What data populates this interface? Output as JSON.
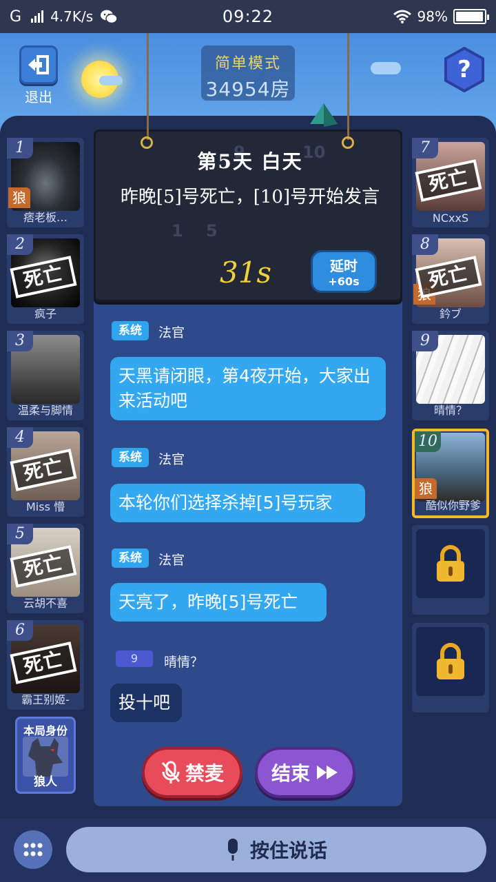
{
  "status_bar": {
    "carrier": "G",
    "speed": "4.7K/s",
    "time": "09:22",
    "battery": "98%",
    "battery_level": 0.98
  },
  "header": {
    "exit_label": "退出",
    "mode": "简单模式",
    "room": "34954房"
  },
  "day_board": {
    "title": "第5天 白天",
    "message": "昨晚[5]号死亡，[10]号开始发言",
    "timer": "31s",
    "extend_label": "延时",
    "extend_amount": "+60s"
  },
  "players_left": [
    {
      "number": "1",
      "name": "痞老板…",
      "wolf": "狼",
      "dead": ""
    },
    {
      "number": "2",
      "name": "疯子",
      "wolf": "",
      "dead": "死亡"
    },
    {
      "number": "3",
      "name": "温柔与脚情",
      "wolf": "",
      "dead": ""
    },
    {
      "number": "4",
      "name": "Miss 懵",
      "wolf": "",
      "dead": "死亡"
    },
    {
      "number": "5",
      "name": "云胡不喜",
      "wolf": "",
      "dead": "死亡"
    },
    {
      "number": "6",
      "name": "霸王别姬-",
      "wolf": "",
      "dead": "死亡"
    }
  ],
  "players_right": [
    {
      "number": "7",
      "name": "NCxxS",
      "wolf": "",
      "dead": "死亡"
    },
    {
      "number": "8",
      "name": "鈐ブ",
      "wolf": "狼",
      "dead": "死亡"
    },
    {
      "number": "9",
      "name": "晴情？",
      "wolf": "",
      "dead": ""
    },
    {
      "number": "10",
      "name": "酷似你野爹",
      "wolf": "狼",
      "dead": ""
    }
  ],
  "identity": {
    "title": "本局身份",
    "role": "狼人"
  },
  "messages": [
    {
      "badge": "系统",
      "sender": "法官",
      "text": "天黑请闭眼，第4夜开始，大家出来活动吧"
    },
    {
      "badge": "系统",
      "sender": "法官",
      "text": "本轮你们选择杀掉[5]号玩家"
    },
    {
      "badge": "系统",
      "sender": "法官",
      "text": "天亮了，昨晚[5]号死亡"
    },
    {
      "badge": "9",
      "sender": "晴情？",
      "text": "投十吧"
    }
  ],
  "controls": {
    "mute_label": "禁麦",
    "end_label": "结束",
    "talk_label": "按住说话"
  },
  "colors": {
    "accent_blue": "#33a7f0",
    "mute_red": "#e84c5a",
    "end_purple": "#8c55d1",
    "self_border": "#f5b928",
    "timer_yellow": "#f1d23b"
  }
}
